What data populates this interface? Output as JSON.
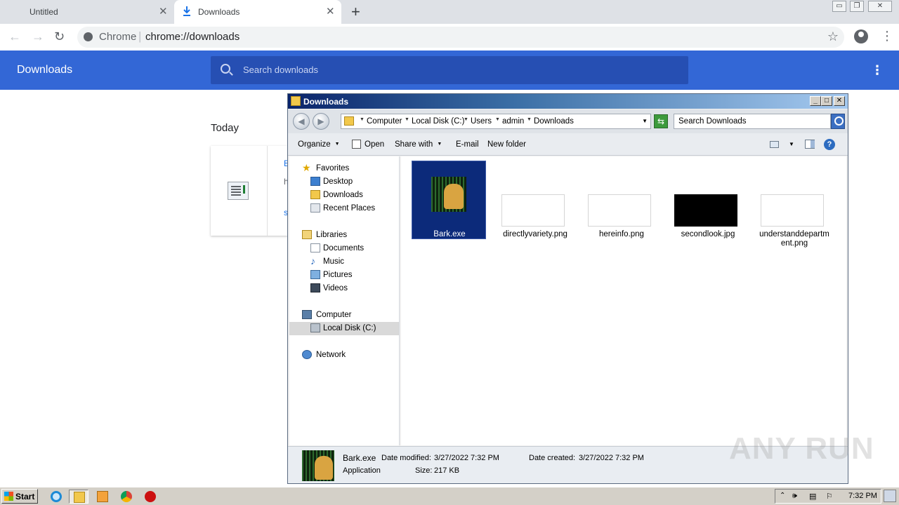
{
  "chrome": {
    "tabs": [
      {
        "title": "Untitled"
      },
      {
        "title": "Downloads"
      }
    ],
    "omnibox": {
      "scheme_label": "Chrome",
      "url": "chrome://downloads"
    },
    "window_controls": {
      "minimize": "▭",
      "restore": "❐",
      "close": "✕"
    }
  },
  "downloads_page": {
    "title": "Downloads",
    "search_placeholder": "Search downloads",
    "section_label": "Today",
    "card_fragments": [
      "B",
      "h",
      "s"
    ]
  },
  "explorer": {
    "title": "Downloads",
    "breadcrumb": [
      "Computer",
      "Local Disk (C:)",
      "Users",
      "admin",
      "Downloads"
    ],
    "search_placeholder": "Search Downloads",
    "commands": {
      "organize": "Organize",
      "open": "Open",
      "share_with": "Share with",
      "email": "E-mail",
      "new_folder": "New folder"
    },
    "nav": {
      "favorites": "Favorites",
      "desktop": "Desktop",
      "downloads": "Downloads",
      "recent_places": "Recent Places",
      "libraries": "Libraries",
      "documents": "Documents",
      "music": "Music",
      "pictures": "Pictures",
      "videos": "Videos",
      "computer": "Computer",
      "local_disk": "Local Disk (C:)",
      "network": "Network"
    },
    "files": [
      {
        "name": "Bark.exe",
        "selected": true
      },
      {
        "name": "directlyvariety.png"
      },
      {
        "name": "hereinfo.png"
      },
      {
        "name": "secondlook.jpg"
      },
      {
        "name": "understanddepartment.png",
        "name_line1": "understanddepartm",
        "name_line2": "ent.png"
      }
    ],
    "details": {
      "name": "Bark.exe",
      "type": "Application",
      "modified_label": "Date modified:",
      "modified_value": "3/27/2022 7:32 PM",
      "created_label": "Date created:",
      "created_value": "3/27/2022 7:32 PM",
      "size_label": "Size:",
      "size_value": "217 KB"
    }
  },
  "taskbar": {
    "start_label": "Start",
    "clock": "7:32 PM"
  },
  "watermark": "ANY RUN",
  "colors": {
    "downloads_header": "#3367d6",
    "selection": "#0c2a7a"
  }
}
